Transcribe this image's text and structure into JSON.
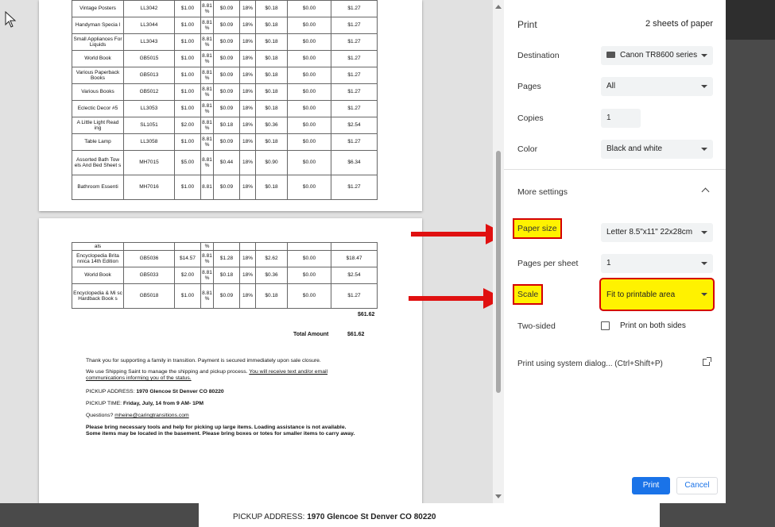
{
  "page1_rows": [
    [
      "Vintage Posters",
      "LL3042",
      "$1.00",
      "8.81 %",
      "$0.09",
      "18%",
      "$0.18",
      "$0.00",
      "$1.27"
    ],
    [
      "Handyman Specia l",
      "LL3044",
      "$1.00",
      "8.81 %",
      "$0.09",
      "18%",
      "$0.18",
      "$0.00",
      "$1.27"
    ],
    [
      "Small Appliances For Liquids",
      "LL3043",
      "$1.00",
      "8.81 %",
      "$0.09",
      "18%",
      "$0.18",
      "$0.00",
      "$1.27"
    ],
    [
      "World Book",
      "GB5015",
      "$1.00",
      "8.81 %",
      "$0.09",
      "18%",
      "$0.18",
      "$0.00",
      "$1.27"
    ],
    [
      "Various Paperback Books",
      "GB5013",
      "$1.00",
      "8.81 %",
      "$0.09",
      "18%",
      "$0.18",
      "$0.00",
      "$1.27"
    ],
    [
      "Various Books",
      "GB5012",
      "$1.00",
      "8.81 %",
      "$0.09",
      "18%",
      "$0.18",
      "$0.00",
      "$1.27"
    ],
    [
      "Eclectic Decor #5",
      "LL3053",
      "$1.00",
      "8.81 %",
      "$0.09",
      "18%",
      "$0.18",
      "$0.00",
      "$1.27"
    ],
    [
      "A Little Light Read ing",
      "SL1051",
      "$2.00",
      "8.81 %",
      "$0.18",
      "18%",
      "$0.36",
      "$0.00",
      "$2.54"
    ],
    [
      "Table Lamp",
      "LL3058",
      "$1.00",
      "8.81 %",
      "$0.09",
      "18%",
      "$0.18",
      "$0.00",
      "$1.27"
    ],
    [
      "Assorted Bath Tow els And Bed Sheet s",
      "MH7015",
      "$5.00",
      "8.81 %",
      "$0.44",
      "18%",
      "$0.90",
      "$0.00",
      "$6.34"
    ],
    [
      "Bathroom Essenti",
      "MH7016",
      "$1.00",
      "8.81",
      "$0.09",
      "18%",
      "$0.18",
      "$0.00",
      "$1.27"
    ]
  ],
  "page2_rows": [
    [
      "als",
      "",
      "",
      "%",
      "",
      "",
      "",
      "",
      ""
    ],
    [
      "Encyclopedia Brita nnica 14th Edition",
      "GB5036",
      "$14.57",
      "8.81 %",
      "$1.28",
      "18%",
      "$2.62",
      "$0.00",
      "$18.47"
    ],
    [
      "World Book",
      "GB5033",
      "$2.00",
      "8.81 %",
      "$0.18",
      "18%",
      "$0.36",
      "$0.00",
      "$2.54"
    ],
    [
      "Encyclopedia & Mi sc Hardback Book s",
      "GB5018",
      "$1.00",
      "8.81 %",
      "$0.09",
      "18%",
      "$0.18",
      "$0.00",
      "$1.27"
    ]
  ],
  "page2": {
    "subtotal": "$61.62",
    "total_label": "Total Amount",
    "total_value": "$61.62",
    "thanks": "Thank you for supporting a family in transition. Payment is secured immediately upon sale closure.",
    "shipping_prefix": "We use Shipping Saint to manage the shipping and pickup process. ",
    "shipping_link": "You will receive text and/or email communications informing you of the status.",
    "pickup_label": "PICKUP ADDRESS: ",
    "pickup_address": "1970 Glencoe St Denver CO 80220",
    "time_label": "PICKUP TIME: ",
    "time_value": "Friday, July, 14 from 9 AM- 1PM",
    "questions_label": "Questions? ",
    "questions_email": "mheine@caringtransitions.com",
    "bring_note": "Please bring necessary tools and help for picking up large items. Loading assistance is not available. Some items may be located in the basement. Please bring boxes or totes for smaller items to carry away."
  },
  "background_page": {
    "pickup_label": "PICKUP ADDRESS: ",
    "pickup_address": "1970 Glencoe St Denver CO 80220"
  },
  "print_panel": {
    "title": "Print",
    "sheets": "2 sheets of paper",
    "destination_label": "Destination",
    "destination_value": "Canon TR8600 series",
    "pages_label": "Pages",
    "pages_value": "All",
    "copies_label": "Copies",
    "copies_value": "1",
    "color_label": "Color",
    "color_value": "Black and white",
    "more_settings": "More settings",
    "paper_size_label": "Paper size",
    "paper_size_value": "Letter 8.5\"x11\" 22x28cm",
    "pages_per_sheet_label": "Pages per sheet",
    "pages_per_sheet_value": "1",
    "scale_label": "Scale",
    "scale_value": "Fit to printable area",
    "two_sided_label": "Two-sided",
    "two_sided_option": "Print on both sides",
    "system_dialog": "Print using system dialog... (Ctrl+Shift+P)",
    "print_button": "Print",
    "cancel_button": "Cancel"
  },
  "colors": {
    "highlight": "#fff200",
    "highlight_border": "#d50000",
    "arrow": "#e01010",
    "primary": "#1a73e8"
  }
}
